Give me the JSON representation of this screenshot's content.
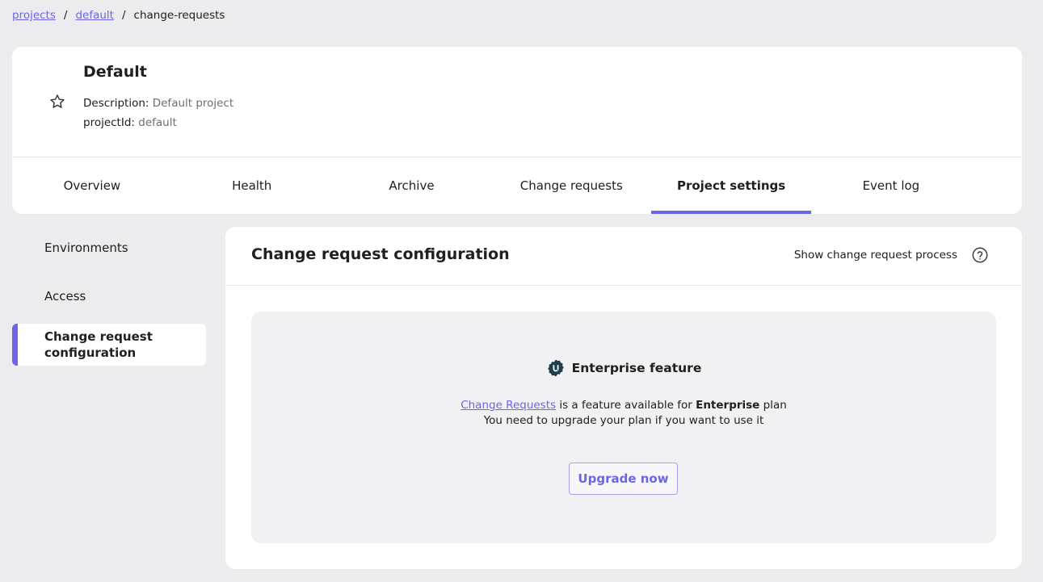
{
  "breadcrumb": {
    "items": [
      "projects",
      "default"
    ],
    "separator": "/",
    "current": "change-requests"
  },
  "project": {
    "name": "Default",
    "description_label": "Description:",
    "description_value": "Default project",
    "id_label": "projectId:",
    "id_value": "default",
    "favorite_icon": "star-outline-icon"
  },
  "tabs": [
    {
      "label": "Overview"
    },
    {
      "label": "Health"
    },
    {
      "label": "Archive"
    },
    {
      "label": "Change requests"
    },
    {
      "label": "Project settings",
      "active": true
    },
    {
      "label": "Event log"
    }
  ],
  "settings_nav": {
    "items": [
      {
        "label": "Environments"
      },
      {
        "label": "Access"
      },
      {
        "label": "Change request configuration",
        "active": true
      }
    ]
  },
  "panel": {
    "title": "Change request configuration",
    "process_link": "Show change request process",
    "help_icon": "help-circle-icon"
  },
  "enterprise": {
    "title": "Enterprise feature",
    "icon": "unleash-logo-icon",
    "link_text": "Change Requests",
    "line1_middle": " is a feature available for ",
    "plan_name": "Enterprise",
    "line1_end": " plan",
    "line2": "You need to upgrade your plan if you want to use it",
    "button_label": "Upgrade now"
  },
  "colors": {
    "accent": "#6c65e5",
    "background": "#ececef",
    "card": "#ffffff",
    "enterprise_box": "#f1f1f3"
  }
}
